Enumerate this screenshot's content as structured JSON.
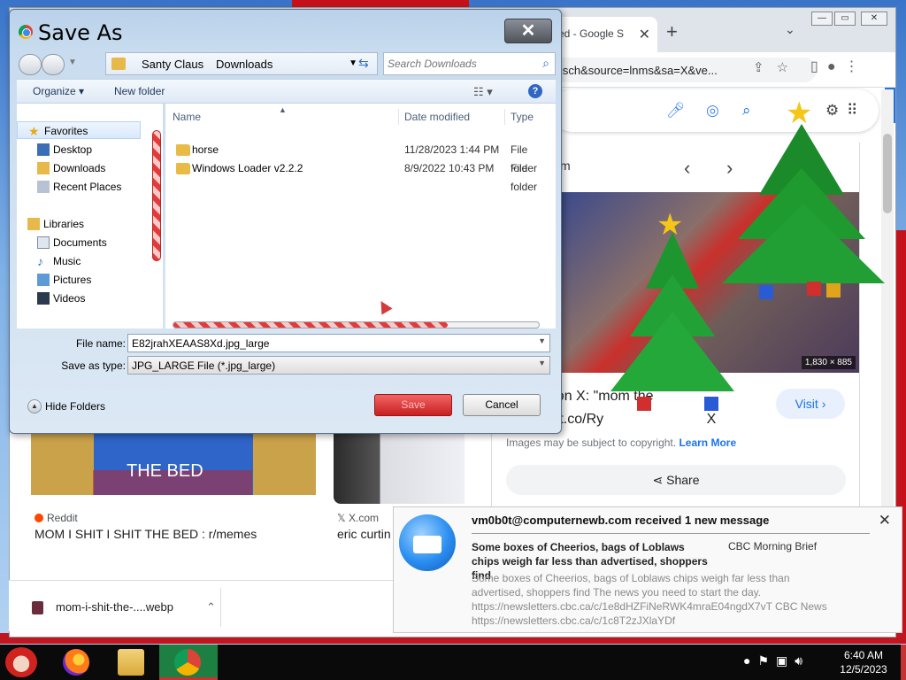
{
  "browser": {
    "tab_title": "ed - Google S",
    "url": "isch&source=lnms&sa=X&ve...",
    "preview_dims": "1,830 × 885",
    "panel_title": "m",
    "panel_link_line1": "e. on X: \"mom   the",
    "panel_link_line2": "s://t.co/Ry",
    "panel_link_tail": "X",
    "visit_label": "Visit",
    "copyright_text": "Images may be subject to copyright.",
    "learn_more": "Learn More",
    "share_label": "Share",
    "results": [
      {
        "thumb_text": "THE BED",
        "source": "Reddit",
        "title": "MOM I SHIT I SHIT THE BED : r/memes"
      },
      {
        "source": "X.com",
        "title": "eric curtin"
      }
    ],
    "download_filename": "mom-i-shit-the-....webp"
  },
  "dialog": {
    "title": "Save As",
    "close_glyph": "✕",
    "breadcrumb": [
      "Santy Claus",
      "Downloads"
    ],
    "search_placeholder": "Search Downloads",
    "organize_label": "Organize",
    "new_folder_label": "New folder",
    "nav_favorites": "Favorites",
    "nav_items_fav": [
      "Desktop",
      "Downloads",
      "Recent Places"
    ],
    "nav_libraries": "Libraries",
    "nav_items_lib": [
      "Documents",
      "Music",
      "Pictures",
      "Videos"
    ],
    "columns": {
      "name": "Name",
      "date": "Date modified",
      "type": "Type"
    },
    "files": [
      {
        "name": "horse",
        "date": "11/28/2023 1:44 PM",
        "type": "File folder"
      },
      {
        "name": "Windows Loader v2.2.2",
        "date": "8/9/2022 10:43 PM",
        "type": "File folder"
      }
    ],
    "file_name_label": "File name:",
    "file_name_value": "E82jrahXEAAS8Xd.jpg_large",
    "save_type_label": "Save as type:",
    "save_type_value": "JPG_LARGE File (*.jpg_large)",
    "hide_folders_label": "Hide Folders",
    "save_label": "Save",
    "cancel_label": "Cancel"
  },
  "notification": {
    "header": "vm0b0t@computernewb.com received 1 new message",
    "subject": "Some boxes of Cheerios, bags of Loblaws chips weigh far less than advertised, shoppers find",
    "sender": "CBC Morning Brief",
    "body": "Some boxes of Cheerios, bags of Loblaws chips weigh far less than advertised, shoppers find The news you need to start the day. https://newsletters.cbc.ca/c/1e8dHZFiNeRWK4mraE04ngdX7vT CBC News https://newsletters.cbc.ca/c/1c8T2zJXlaYDf",
    "close_glyph": "✕"
  },
  "taskbar": {
    "time": "6:40 AM",
    "date": "12/5/2023"
  },
  "colors": {
    "desktop_red": "#c5121a",
    "save_button_red": "#d9302f",
    "taskbar_active": "#1e7f42",
    "link_blue": "#1a73e8"
  }
}
